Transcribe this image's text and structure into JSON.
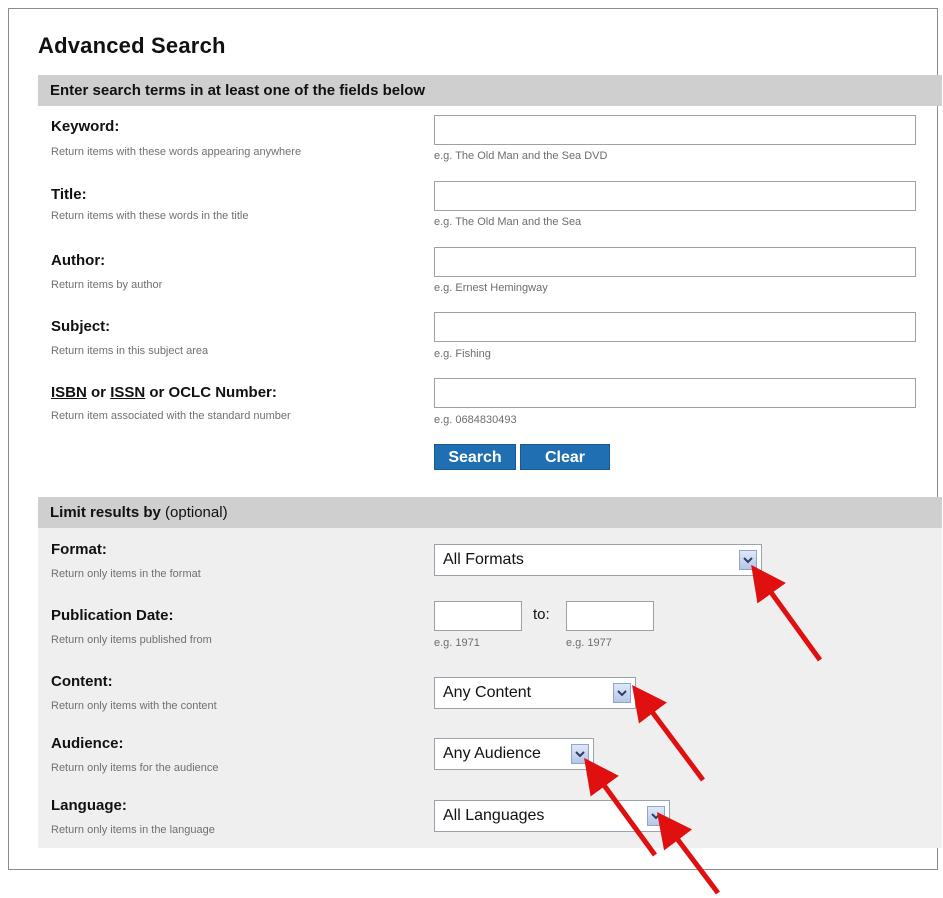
{
  "page_title": "Advanced Search",
  "search_section": {
    "header": "Enter search terms in at least one of the fields below",
    "fields": [
      {
        "label": "Keyword:",
        "help": "Return items with these words appearing anywhere",
        "value": "",
        "example": "e.g. The Old Man and the Sea DVD"
      },
      {
        "label": "Title:",
        "help": "Return items with these words in the title",
        "value": "",
        "example": "e.g. The Old Man and the Sea"
      },
      {
        "label": "Author:",
        "help": "Return items by author",
        "value": "",
        "example": "e.g. Ernest Hemingway"
      },
      {
        "label": "Subject:",
        "help": "Return items in this subject area",
        "value": "",
        "example": "e.g. Fishing"
      },
      {
        "label_parts": [
          "ISBN",
          " or ",
          "ISSN",
          " or OCLC Number:"
        ],
        "help": "Return item associated with the standard number",
        "value": "",
        "example": "e.g. 0684830493"
      }
    ],
    "search_label": "Search",
    "clear_label": "Clear"
  },
  "limit_section": {
    "header": "Limit results by",
    "header_optional": "(optional)",
    "format": {
      "label": "Format:",
      "help": "Return only items in the format",
      "selected": "All Formats"
    },
    "publication_date": {
      "label": "Publication Date:",
      "help": "Return only items published from",
      "from_value": "",
      "to_label": "to:",
      "to_value": "",
      "from_example": "e.g. 1971",
      "to_example": "e.g. 1977"
    },
    "content": {
      "label": "Content:",
      "help": "Return only items with the content",
      "selected": "Any Content"
    },
    "audience": {
      "label": "Audience:",
      "help": "Return only items for the audience",
      "selected": "Any Audience"
    },
    "language": {
      "label": "Language:",
      "help": "Return only items in the language",
      "selected": "All Languages"
    }
  },
  "colors": {
    "button": "#1f6fb2",
    "header_bg": "#cfcfcf",
    "annotation_arrow": "#e01010"
  },
  "annotations": {
    "icon": "red-arrow-icon",
    "count": 4
  }
}
